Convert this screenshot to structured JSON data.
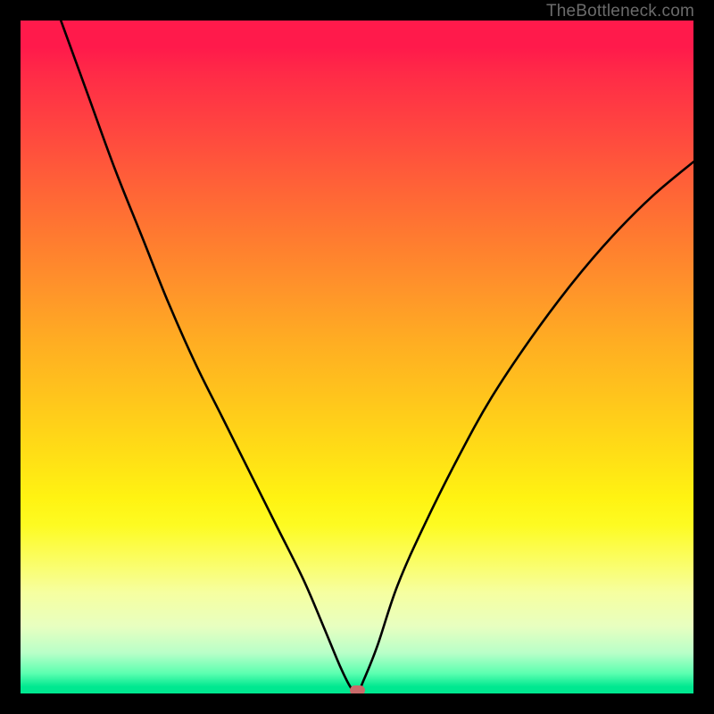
{
  "watermark": "TheBottleneck.com",
  "colors": {
    "frame": "#000000",
    "curve": "#000000",
    "marker": "#c96a6a"
  },
  "chart_data": {
    "type": "line",
    "title": "",
    "xlabel": "",
    "ylabel": "",
    "xlim": [
      0,
      100
    ],
    "ylim": [
      0,
      100
    ],
    "grid": false,
    "series": [
      {
        "name": "bottleneck-curve",
        "x": [
          6,
          10,
          14,
          18,
          22,
          26,
          30,
          34,
          38,
          42,
          45,
          47.5,
          49,
          50,
          51,
          53,
          56,
          60,
          65,
          70,
          76,
          82,
          88,
          94,
          100
        ],
        "values": [
          100,
          89,
          78,
          68,
          58,
          49,
          41,
          33,
          25,
          17,
          10,
          4,
          1,
          0,
          2,
          7,
          16,
          25,
          35,
          44,
          53,
          61,
          68,
          74,
          79
        ]
      }
    ],
    "annotations": [
      {
        "name": "optimal-marker",
        "x": 50,
        "y": 0
      }
    ],
    "background_gradient": {
      "direction": "vertical",
      "stops": [
        {
          "pos": 0.0,
          "color": "#ff1a4b"
        },
        {
          "pos": 0.5,
          "color": "#ffae22"
        },
        {
          "pos": 0.75,
          "color": "#fdfb22"
        },
        {
          "pos": 0.97,
          "color": "#5cffb0"
        },
        {
          "pos": 1.0,
          "color": "#00e890"
        }
      ]
    }
  }
}
